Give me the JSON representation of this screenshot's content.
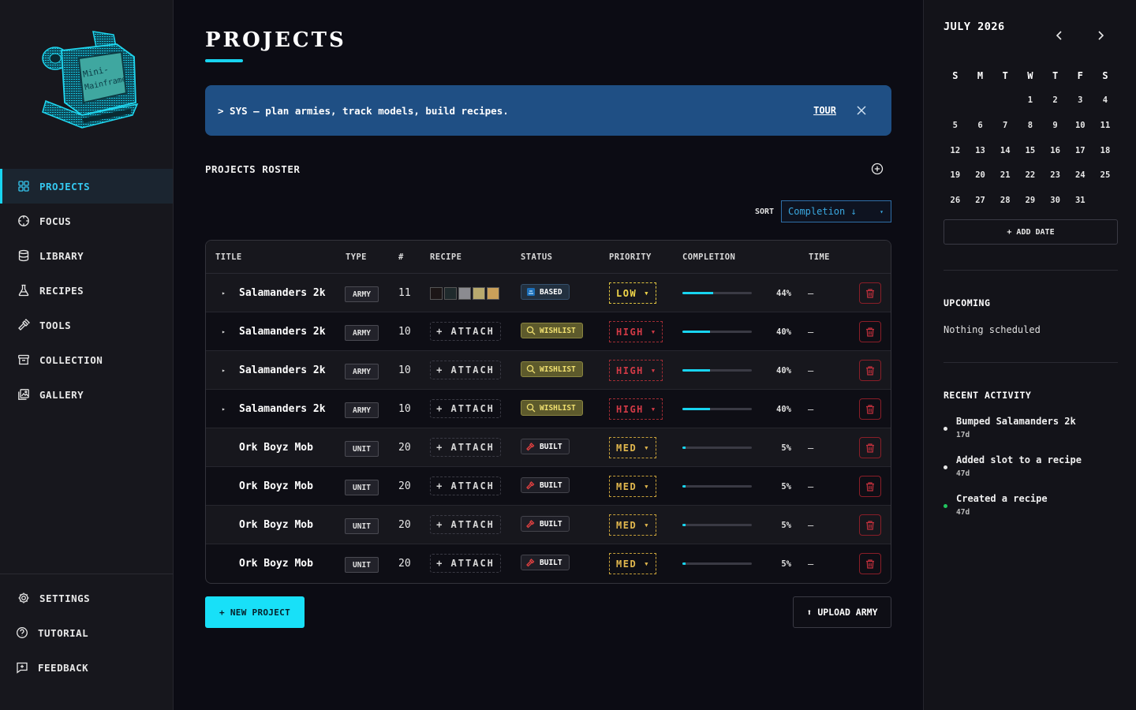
{
  "app": {
    "logo_text": "Mini-Mainframe"
  },
  "sidebar": {
    "items": [
      {
        "label": "PROJECTS",
        "icon": "grid-icon"
      },
      {
        "label": "FOCUS",
        "icon": "crosshair-icon"
      },
      {
        "label": "LIBRARY",
        "icon": "database-icon"
      },
      {
        "label": "RECIPES",
        "icon": "flask-icon"
      },
      {
        "label": "TOOLS",
        "icon": "hammer-icon"
      },
      {
        "label": "COLLECTION",
        "icon": "archive-icon"
      },
      {
        "label": "GALLERY",
        "icon": "image-icon"
      }
    ],
    "bottom": [
      {
        "label": "SETTINGS",
        "icon": "gear-icon"
      },
      {
        "label": "TUTORIAL",
        "icon": "help-icon"
      },
      {
        "label": "FEEDBACK",
        "icon": "feedback-icon"
      }
    ]
  },
  "main": {
    "title": "PROJECTS",
    "banner": {
      "text": "> SYS — plan armies, track models, build recipes.",
      "tour": "TOUR"
    },
    "roster_title": "PROJECTS ROSTER",
    "sort": {
      "label": "SORT",
      "value": "Completion ↓",
      "caret": "▾"
    },
    "table": {
      "headers": [
        "TITLE",
        "TYPE",
        "#",
        "RECIPE",
        "STATUS",
        "PRIORITY",
        "COMPLETION",
        "TIME"
      ],
      "rows": [
        {
          "expandable": true,
          "title": "Salamanders 2k",
          "type": "ARMY",
          "count": "11",
          "recipe": "swatches",
          "swatches": [
            "#1c1616",
            "#1f2a2c",
            "#8b8b90",
            "#b9aa6e",
            "#c9a05a"
          ],
          "status": "BASED",
          "status_kind": "based",
          "priority": "LOW",
          "priority_kind": "low",
          "completion": 44,
          "completion_label": "44%",
          "time": "—"
        },
        {
          "expandable": true,
          "title": "Salamanders 2k",
          "type": "ARMY",
          "count": "10",
          "recipe": "+ ATTACH",
          "status": "WISHLIST",
          "status_kind": "wishlist",
          "priority": "HIGH",
          "priority_kind": "high",
          "completion": 40,
          "completion_label": "40%",
          "time": "—"
        },
        {
          "expandable": true,
          "title": "Salamanders 2k",
          "type": "ARMY",
          "count": "10",
          "recipe": "+ ATTACH",
          "status": "WISHLIST",
          "status_kind": "wishlist",
          "priority": "HIGH",
          "priority_kind": "high",
          "completion": 40,
          "completion_label": "40%",
          "time": "—"
        },
        {
          "expandable": true,
          "title": "Salamanders 2k",
          "type": "ARMY",
          "count": "10",
          "recipe": "+ ATTACH",
          "status": "WISHLIST",
          "status_kind": "wishlist",
          "priority": "HIGH",
          "priority_kind": "high",
          "completion": 40,
          "completion_label": "40%",
          "time": "—"
        },
        {
          "expandable": false,
          "title": "Ork Boyz Mob",
          "type": "UNIT",
          "count": "20",
          "recipe": "+ ATTACH",
          "status": "BUILT",
          "status_kind": "built",
          "priority": "MED",
          "priority_kind": "med",
          "completion": 5,
          "completion_label": "5%",
          "time": "—"
        },
        {
          "expandable": false,
          "title": "Ork Boyz Mob",
          "type": "UNIT",
          "count": "20",
          "recipe": "+ ATTACH",
          "status": "BUILT",
          "status_kind": "built",
          "priority": "MED",
          "priority_kind": "med",
          "completion": 5,
          "completion_label": "5%",
          "time": "—"
        },
        {
          "expandable": false,
          "title": "Ork Boyz Mob",
          "type": "UNIT",
          "count": "20",
          "recipe": "+ ATTACH",
          "status": "BUILT",
          "status_kind": "built",
          "priority": "MED",
          "priority_kind": "med",
          "completion": 5,
          "completion_label": "5%",
          "time": "—"
        },
        {
          "expandable": false,
          "title": "Ork Boyz Mob",
          "type": "UNIT",
          "count": "20",
          "recipe": "+ ATTACH",
          "status": "BUILT",
          "status_kind": "built",
          "priority": "MED",
          "priority_kind": "med",
          "completion": 5,
          "completion_label": "5%",
          "time": "—"
        }
      ]
    },
    "new_project": "+ NEW PROJECT",
    "upload_army": "⬆ UPLOAD ARMY"
  },
  "calendar": {
    "month": "JULY 2026",
    "weekdays": [
      "S",
      "M",
      "T",
      "W",
      "T",
      "F",
      "S"
    ],
    "weeks": [
      [
        "",
        "",
        "",
        "1",
        "2",
        "3",
        "4"
      ],
      [
        "5",
        "6",
        "7",
        "8",
        "9",
        "10",
        "11"
      ],
      [
        "12",
        "13",
        "14",
        "15",
        "16",
        "17",
        "18"
      ],
      [
        "19",
        "20",
        "21",
        "22",
        "23",
        "24",
        "25"
      ],
      [
        "26",
        "27",
        "28",
        "29",
        "30",
        "31",
        ""
      ]
    ],
    "add_date": "+ ADD DATE"
  },
  "upcoming": {
    "title": "UPCOMING",
    "empty": "Nothing scheduled"
  },
  "activity": {
    "title": "RECENT ACTIVITY",
    "items": [
      {
        "text": "Bumped Salamanders 2k",
        "time": "17d",
        "color": "#e8e8e8"
      },
      {
        "text": "Added slot to a recipe",
        "time": "47d",
        "color": "#e8e8e8"
      },
      {
        "text": "Created a recipe",
        "time": "47d",
        "color": "#22c55e"
      }
    ]
  },
  "colors": {
    "accent": "#18d4f0",
    "banner": "#1f4f84",
    "danger": "#c0303c",
    "low": "#f2d74a",
    "high": "#d23a46",
    "med": "#e2b84e"
  }
}
